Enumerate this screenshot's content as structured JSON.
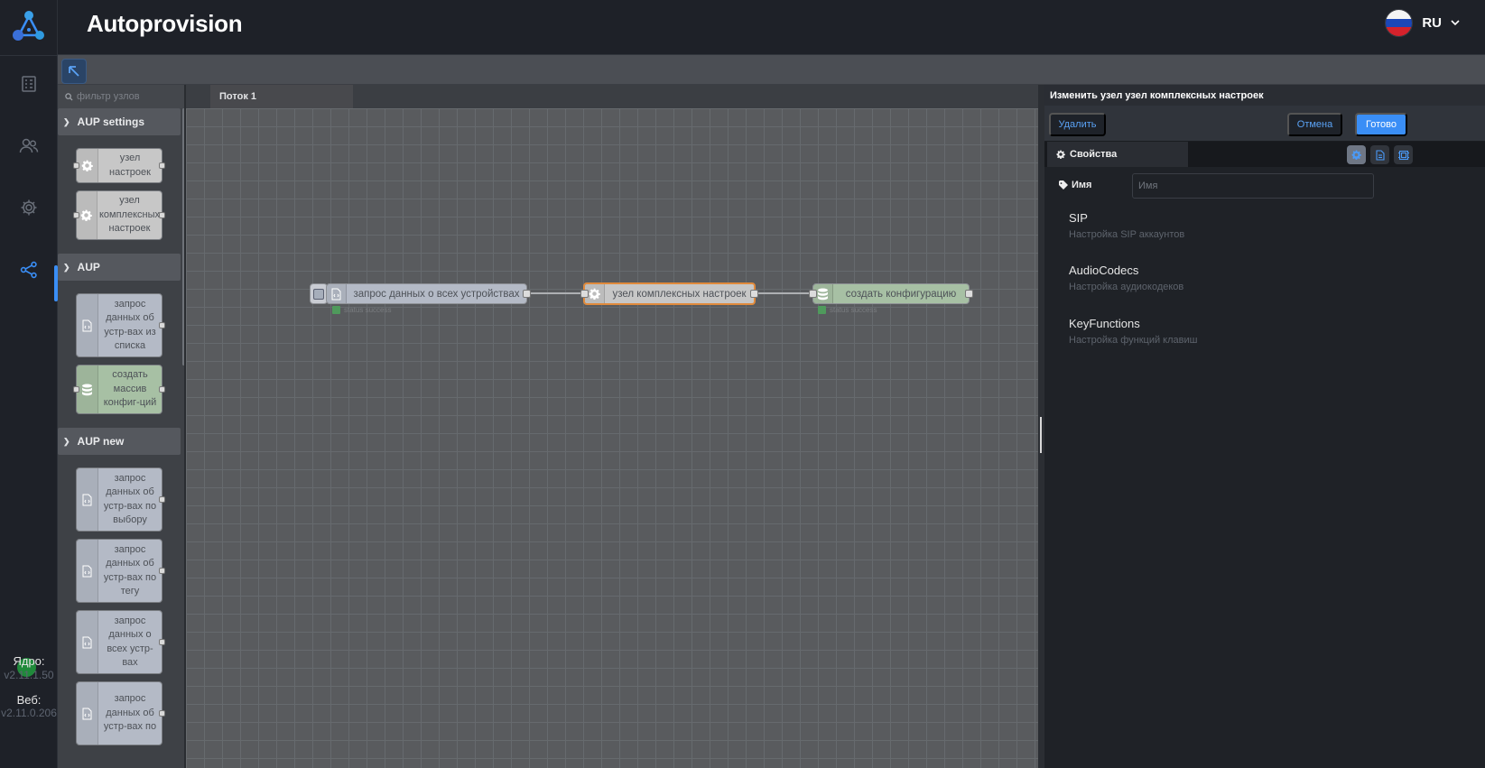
{
  "app": {
    "title": "Autoprovision"
  },
  "language": {
    "code": "RU"
  },
  "sidebar": {
    "core_label": "Ядро:",
    "core_version": "v2.11.1.50",
    "web_label": "Веб:",
    "web_version": "v2.11.0.206"
  },
  "palette": {
    "filter_placeholder": "фильтр узлов",
    "categories": [
      {
        "label": "AUP settings"
      },
      {
        "label": "AUP"
      },
      {
        "label": "AUP new"
      }
    ],
    "nodes": [
      {
        "label": "узел настроек",
        "icon": "gear-icon"
      },
      {
        "label": "узел комплексных настроек",
        "icon": "gear-icon"
      },
      {
        "label": "запрос данных об устр-вах из списка",
        "icon": "code-file-icon"
      },
      {
        "label": "создать массив конфиг-ций",
        "icon": "database-icon"
      },
      {
        "label": "запрос данных об устр-вах по выбору",
        "icon": "code-file-icon"
      },
      {
        "label": "запрос данных об устр-вах по тегу",
        "icon": "code-file-icon"
      },
      {
        "label": "запрос данных о всех устр-вах",
        "icon": "code-file-icon"
      },
      {
        "label": "запрос данных об устр-вах по",
        "icon": "code-file-icon"
      }
    ]
  },
  "workspace": {
    "flow_tab": "Поток 1",
    "nodes": [
      {
        "label": "запрос данных о всех устройствах",
        "status": "status success"
      },
      {
        "label": "узел комплексных настроек"
      },
      {
        "label": "создать конфигурацию",
        "status": "status success"
      }
    ]
  },
  "tray": {
    "title": "Изменить узел узел комплексных настроек",
    "delete_label": "Удалить",
    "cancel_label": "Отмена",
    "done_label": "Готово",
    "properties_tab": "Свойства",
    "name_label": "Имя",
    "name_placeholder": "Имя",
    "sections": [
      {
        "title": "SIP",
        "desc": "Настройка SIP аккаунтов"
      },
      {
        "title": "AudioCodecs",
        "desc": "Настройка аудиокодеков"
      },
      {
        "title": "KeyFunctions",
        "desc": "Настройка функций клавиш"
      }
    ]
  },
  "colors": {
    "accent": "#3a8ef6",
    "selected_outline": "#e08a3c",
    "status_ok": "#1f8a3a"
  }
}
